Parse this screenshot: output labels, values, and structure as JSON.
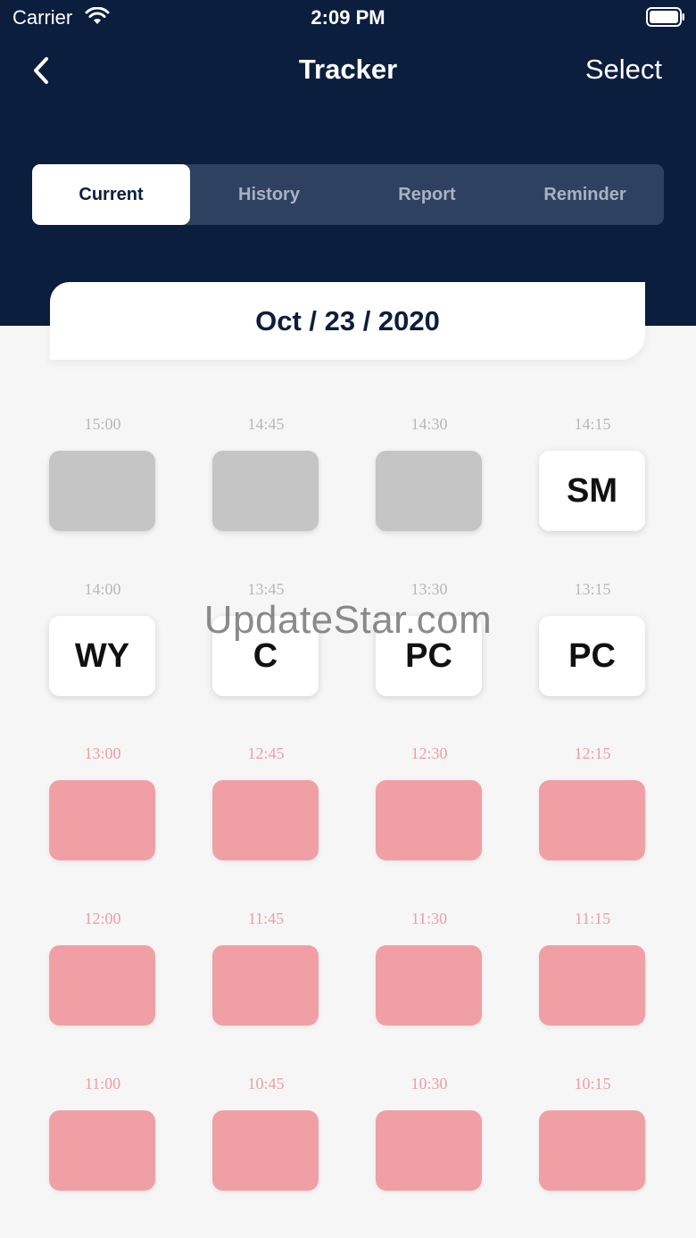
{
  "status_bar": {
    "carrier": "Carrier",
    "time": "2:09 PM"
  },
  "nav": {
    "title": "Tracker",
    "select_label": "Select"
  },
  "tabs": [
    {
      "label": "Current",
      "active": true
    },
    {
      "label": "History",
      "active": false
    },
    {
      "label": "Report",
      "active": false
    },
    {
      "label": "Reminder",
      "active": false
    }
  ],
  "date": "Oct / 23 / 2020",
  "slots": [
    [
      {
        "time": "15:00",
        "label": "",
        "state": "empty"
      },
      {
        "time": "14:45",
        "label": "",
        "state": "empty"
      },
      {
        "time": "14:30",
        "label": "",
        "state": "empty"
      },
      {
        "time": "14:15",
        "label": "SM",
        "state": "filled"
      }
    ],
    [
      {
        "time": "14:00",
        "label": "WY",
        "state": "filled"
      },
      {
        "time": "13:45",
        "label": "C",
        "state": "filled"
      },
      {
        "time": "13:30",
        "label": "PC",
        "state": "filled"
      },
      {
        "time": "13:15",
        "label": "PC",
        "state": "filled"
      }
    ],
    [
      {
        "time": "13:00",
        "label": "",
        "state": "future"
      },
      {
        "time": "12:45",
        "label": "",
        "state": "future"
      },
      {
        "time": "12:30",
        "label": "",
        "state": "future"
      },
      {
        "time": "12:15",
        "label": "",
        "state": "future"
      }
    ],
    [
      {
        "time": "12:00",
        "label": "",
        "state": "future"
      },
      {
        "time": "11:45",
        "label": "",
        "state": "future"
      },
      {
        "time": "11:30",
        "label": "",
        "state": "future"
      },
      {
        "time": "11:15",
        "label": "",
        "state": "future"
      }
    ],
    [
      {
        "time": "11:00",
        "label": "",
        "state": "future"
      },
      {
        "time": "10:45",
        "label": "",
        "state": "future"
      },
      {
        "time": "10:30",
        "label": "",
        "state": "future"
      },
      {
        "time": "10:15",
        "label": "",
        "state": "future"
      }
    ]
  ],
  "watermark": "UpdateStar.com",
  "colors": {
    "header_bg": "#0b1e3e",
    "empty_slot": "#c5c5c5",
    "future_slot": "#f0a0a5",
    "future_time": "#ee9ea3",
    "past_time": "#b8b8b8"
  }
}
